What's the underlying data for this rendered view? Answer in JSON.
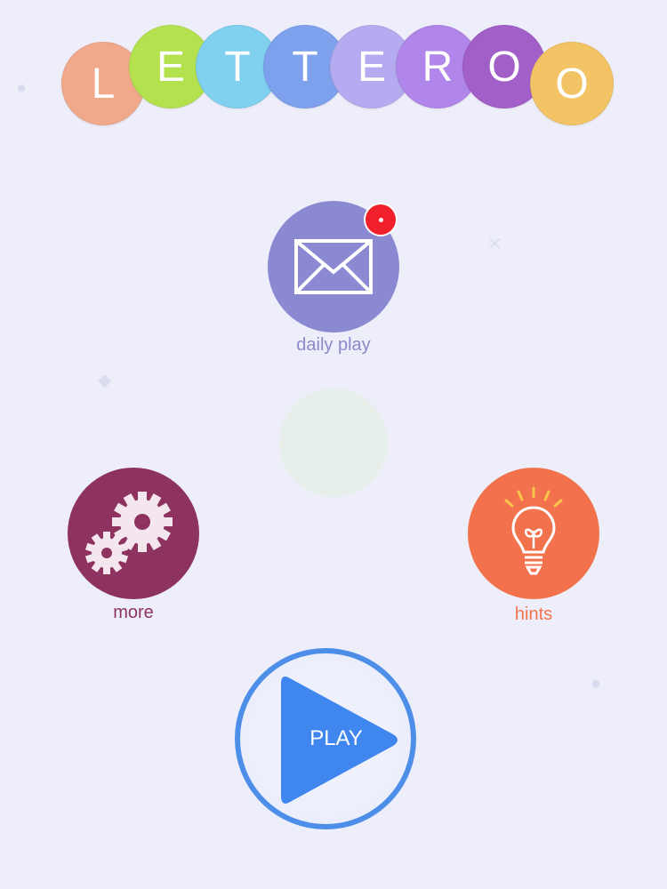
{
  "logo": {
    "letters": [
      {
        "char": "L",
        "color": "#f2a98b"
      },
      {
        "char": "E",
        "color": "#b4e24f"
      },
      {
        "char": "T",
        "color": "#7fd1ef"
      },
      {
        "char": "T",
        "color": "#7ea1ed"
      },
      {
        "char": "E",
        "color": "#b4abf0"
      },
      {
        "char": "R",
        "color": "#b186ea"
      },
      {
        "char": "O",
        "color": "#a25fc8"
      },
      {
        "char": "O",
        "color": "#f3c465"
      }
    ]
  },
  "daily_play": {
    "label": "daily play",
    "color": "#8b89d1",
    "label_color": "#8b89c9",
    "icon": "envelope-icon",
    "badge_color": "#f2202b"
  },
  "more": {
    "label": "more",
    "color": "#8e3260",
    "label_color": "#8e3260",
    "icon": "gears-icon"
  },
  "hints": {
    "label": "hints",
    "color": "#f3724e",
    "label_color": "#f3724e",
    "icon": "lightbulb-icon"
  },
  "play": {
    "label": "PLAY",
    "ring_color": "#4d8fe8",
    "triangle_color": "#3f86ef",
    "icon": "play-icon"
  }
}
